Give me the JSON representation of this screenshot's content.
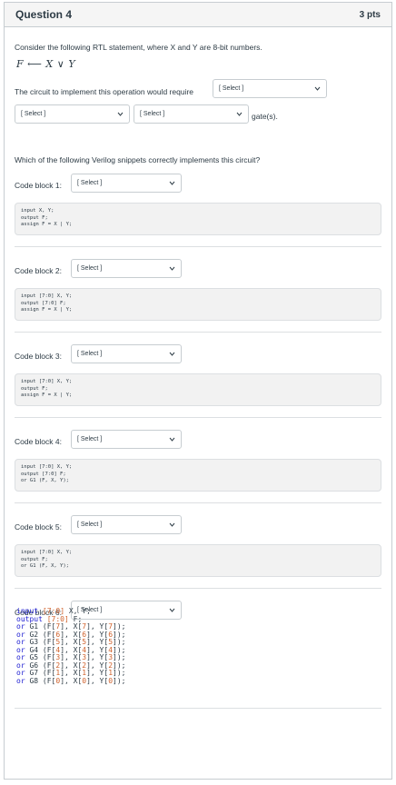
{
  "question": {
    "title": "Question 4",
    "points": "3 pts"
  },
  "prompt": "Consider the following RTL statement, where X and Y are 8-bit numbers.",
  "rtl": {
    "lhs": "F",
    "arrow": "⟵",
    "x": "X",
    "or": "∨",
    "y": "Y"
  },
  "circuit_text": "The circuit to implement this operation would require",
  "select_placeholder": "[ Select ]",
  "gates_suffix": "gate(s).",
  "which_text": "Which of the following Verilog snippets correctly implements this circuit?",
  "code_blocks": [
    {
      "label": "Code block 1:",
      "code": "input X, Y;\noutput F;\nassign F = X | Y;"
    },
    {
      "label": "Code block 2:",
      "code": "input [7:0] X, Y;\noutput [7:0] F;\nassign F = X | Y;"
    },
    {
      "label": "Code block 3:",
      "code": "input [7:0] X, Y;\noutput F;\nassign F = X | Y;"
    },
    {
      "label": "Code block 4:",
      "code": "input [7:0] X, Y;\noutput [7:0] F;\nor G1 (F, X, Y);"
    },
    {
      "label": "Code block 5:",
      "code": "input [7:0] X, Y;\noutput F;\nor G1 (F, X, Y);"
    },
    {
      "label": "Code block 6:"
    }
  ],
  "block6": {
    "line1": {
      "kw": "input",
      "range": "[7:0]",
      "rest": " X, Y;"
    },
    "line2": {
      "kw": "output",
      "range": "[7:0]",
      "rest": " F;"
    },
    "gates": [
      {
        "kw": "or",
        "name": " G1 (F[",
        "i": "7",
        "m1": "], X[",
        "m2": "], Y[",
        "end": "]);"
      },
      {
        "kw": "or",
        "name": " G2 (F[",
        "i": "6",
        "m1": "], X[",
        "m2": "], Y[",
        "end": "]);"
      },
      {
        "kw": "or",
        "name": " G3 (F[",
        "i": "5",
        "m1": "], X[",
        "m2": "], Y[",
        "end": "]);"
      },
      {
        "kw": "or",
        "name": " G4 (F[",
        "i": "4",
        "m1": "], X[",
        "m2": "], Y[",
        "end": "]);"
      },
      {
        "kw": "or",
        "name": " G5 (F[",
        "i": "3",
        "m1": "], X[",
        "m2": "], Y[",
        "end": "]);"
      },
      {
        "kw": "or",
        "name": " G6 (F[",
        "i": "2",
        "m1": "], X[",
        "m2": "], Y[",
        "end": "]);"
      },
      {
        "kw": "or",
        "name": " G7 (F[",
        "i": "1",
        "m1": "], X[",
        "m2": "], Y[",
        "end": "]);"
      },
      {
        "kw": "or",
        "name": " G8 (F[",
        "i": "0",
        "m1": "], X[",
        "m2": "], Y[",
        "end": "]);"
      }
    ]
  },
  "colors": {
    "keyword": "#1b1bd1",
    "number": "#d0622c",
    "border": "#c7cdd1",
    "codebg": "#f2f2f2"
  },
  "icons": {
    "dropdown": "chevron-down-icon"
  }
}
